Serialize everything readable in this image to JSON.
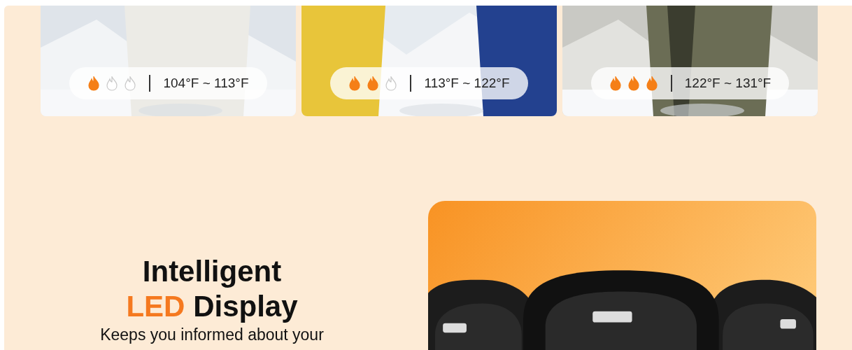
{
  "heat_levels": [
    {
      "stars": 1,
      "range": "104°F ~ 113°F"
    },
    {
      "stars": 2,
      "range": "113°F ~ 122°F"
    },
    {
      "stars": 3,
      "range": "122°F ~ 131°F"
    }
  ],
  "feature": {
    "title_line_1": "Intelligent",
    "title_highlight": "LED",
    "title_rest": "Display",
    "description": "Keeps you informed about your"
  }
}
